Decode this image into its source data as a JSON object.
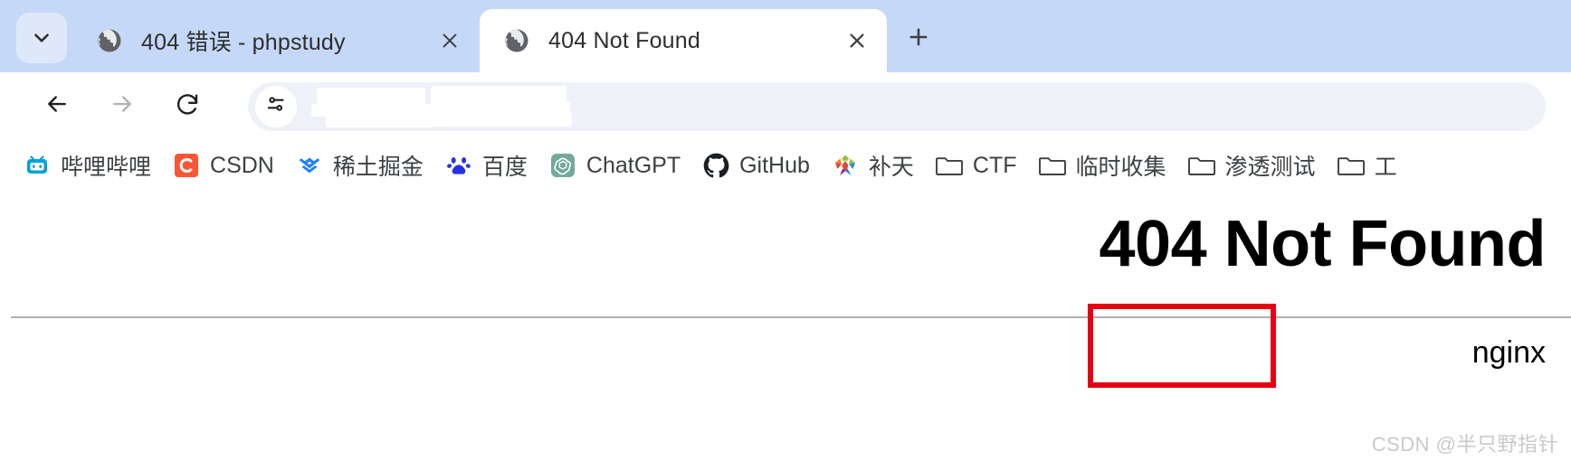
{
  "browser": {
    "tab_search": {
      "icon": "chevron-down-icon",
      "tooltip": "Search tabs"
    },
    "tabs": [
      {
        "title": "404 错误 - phpstudy",
        "favicon": "globe-icon",
        "active": false,
        "close_label": "×"
      },
      {
        "title": "404 Not Found",
        "favicon": "globe-icon",
        "active": true,
        "close_label": "×"
      }
    ],
    "new_tab": {
      "label": "+",
      "icon": "plus-icon"
    },
    "toolbar": {
      "back": {
        "icon": "arrow-left-icon",
        "enabled": true
      },
      "forward": {
        "icon": "arrow-right-icon",
        "enabled": false
      },
      "reload": {
        "icon": "reload-icon"
      },
      "omnibox": {
        "site_settings_icon": "tune-icon",
        "url": "",
        "placeholder": ""
      }
    },
    "bookmarks": [
      {
        "label": "哔哩哔哩",
        "icon": "bilibili-icon"
      },
      {
        "label": "CSDN",
        "icon": "csdn-icon"
      },
      {
        "label": "稀土掘金",
        "icon": "juejin-icon"
      },
      {
        "label": "百度",
        "icon": "baidu-icon"
      },
      {
        "label": "ChatGPT",
        "icon": "chatgpt-icon"
      },
      {
        "label": "GitHub",
        "icon": "github-icon"
      },
      {
        "label": "补天",
        "icon": "butian-icon"
      },
      {
        "label": "CTF",
        "icon": "folder-icon"
      },
      {
        "label": "临时收集",
        "icon": "folder-icon"
      },
      {
        "label": "渗透测试",
        "icon": "folder-icon"
      },
      {
        "label": "工",
        "icon": "folder-icon"
      }
    ]
  },
  "page": {
    "title": "404 Not Found",
    "server_signature": "nginx",
    "divider": true
  },
  "annotation": {
    "box_color": "#e60012",
    "target": "nginx"
  },
  "watermark": {
    "text": "CSDN @半只野指针"
  }
}
